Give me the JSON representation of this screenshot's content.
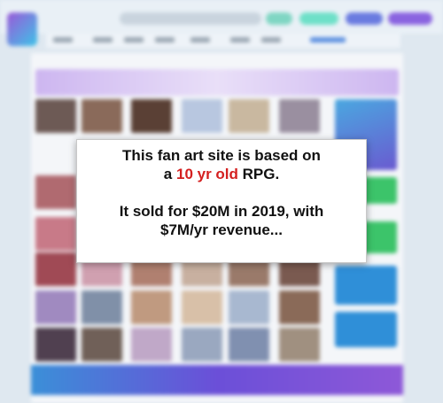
{
  "overlay": {
    "line1": "This fan art site is based on",
    "line2_pre": "a ",
    "line2_highlight": "10 yr old",
    "line2_post": " RPG.",
    "line3": "It sold for $20M in 2019, with",
    "line4": "$7M/yr revenue...",
    "highlight_color": "#d42020"
  },
  "site": {
    "logo_icon": "site-logo-icon",
    "accent_colors": [
      "#9b59d8",
      "#3cc3e8",
      "#8e58d8"
    ]
  }
}
